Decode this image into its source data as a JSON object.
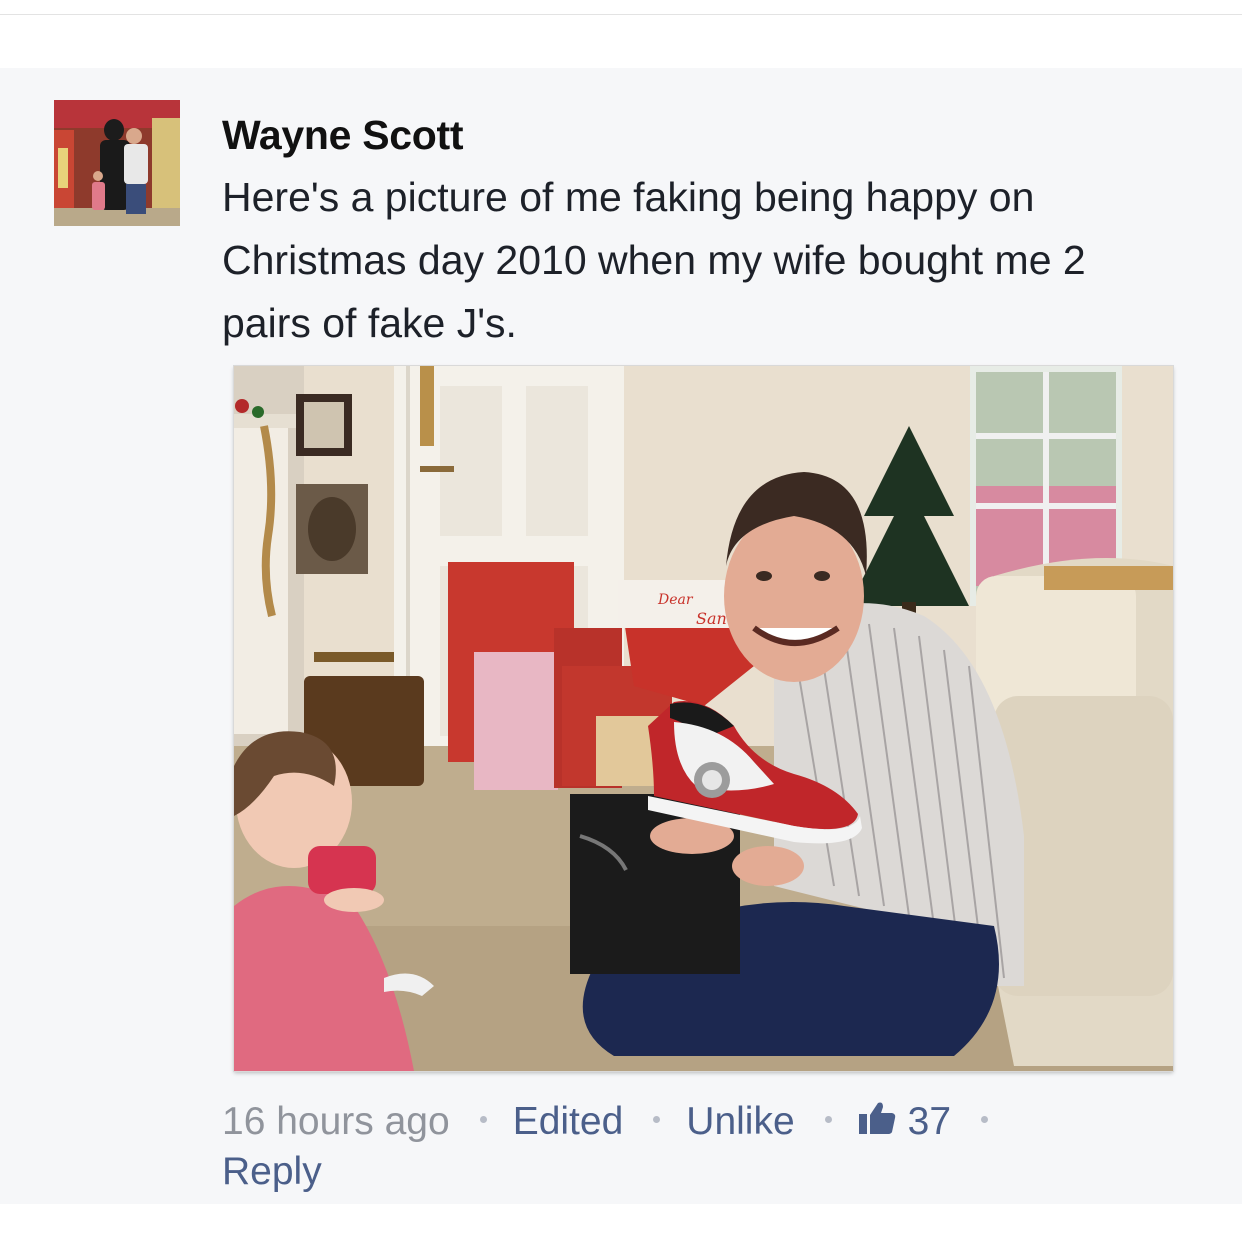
{
  "comment": {
    "author": "Wayne Scott",
    "text": "Here's a picture of me faking being happy on Christmas day 2010 when my wife bought me 2 pairs of fake J's."
  },
  "meta": {
    "time": "16 hours ago",
    "edited": "Edited",
    "unlike": "Unlike",
    "like_count": "37",
    "reply": "Reply"
  },
  "photo": {
    "bag_text_1": "Dear",
    "bag_text_2": "Santa"
  },
  "colors": {
    "link": "#4b5f8a",
    "muted": "#90949c",
    "panel": "#f6f7f9",
    "text": "#1d2129"
  },
  "icons": [
    "thumbs-up-icon",
    "dot-separator-icon"
  ]
}
